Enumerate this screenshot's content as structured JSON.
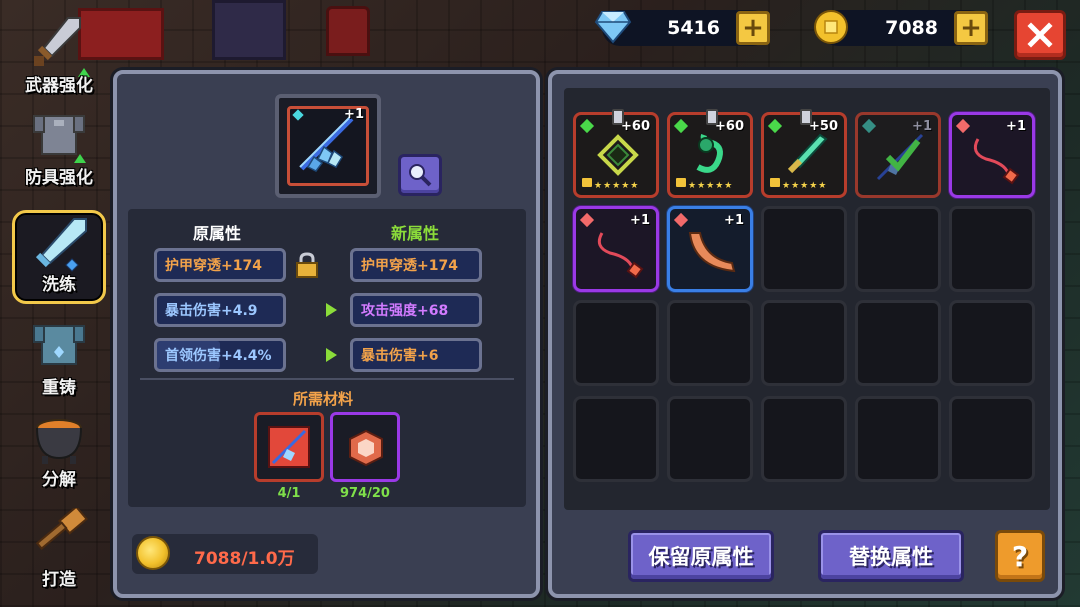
{
  "nav": [
    {
      "id": "weapon-enhance",
      "label": "武器强化"
    },
    {
      "id": "armor-enhance",
      "label": "防具强化"
    },
    {
      "id": "refine",
      "label": "洗练",
      "active": true
    },
    {
      "id": "recast",
      "label": "重铸"
    },
    {
      "id": "decompose",
      "label": "分解"
    },
    {
      "id": "forge",
      "label": "打造"
    }
  ],
  "currency": {
    "gems": "5416",
    "gold": "7088"
  },
  "refine": {
    "item_level": "+1",
    "old_title": "原属性",
    "new_title": "新属性",
    "old_stats": [
      "护甲穿透+174",
      "暴击伤害+4.9",
      "首领伤害+4.4%"
    ],
    "new_stats": [
      "护甲穿透+174",
      "攻击强度+68",
      "暴击伤害+6"
    ],
    "materials_title": "所需材料",
    "materials": [
      {
        "count": "4/1"
      },
      {
        "count": "974/20"
      }
    ],
    "gold_cost": "7088/1.0万"
  },
  "inventory": {
    "items": [
      {
        "plus": "+60",
        "stars": "★★★★★"
      },
      {
        "plus": "+60",
        "stars": "★★★★★"
      },
      {
        "plus": "+50",
        "stars": "★★★★★"
      },
      {
        "plus": "+1"
      },
      {
        "plus": "+1"
      },
      {
        "plus": "+1"
      },
      {
        "plus": "+1"
      }
    ]
  },
  "buttons": {
    "keep": "保留原属性",
    "replace": "替换属性",
    "help": "?"
  },
  "colors": {
    "accent": "#6e62c9",
    "close": "#e64532",
    "gold": "#f4c842",
    "new_title": "#8bdc3a"
  }
}
